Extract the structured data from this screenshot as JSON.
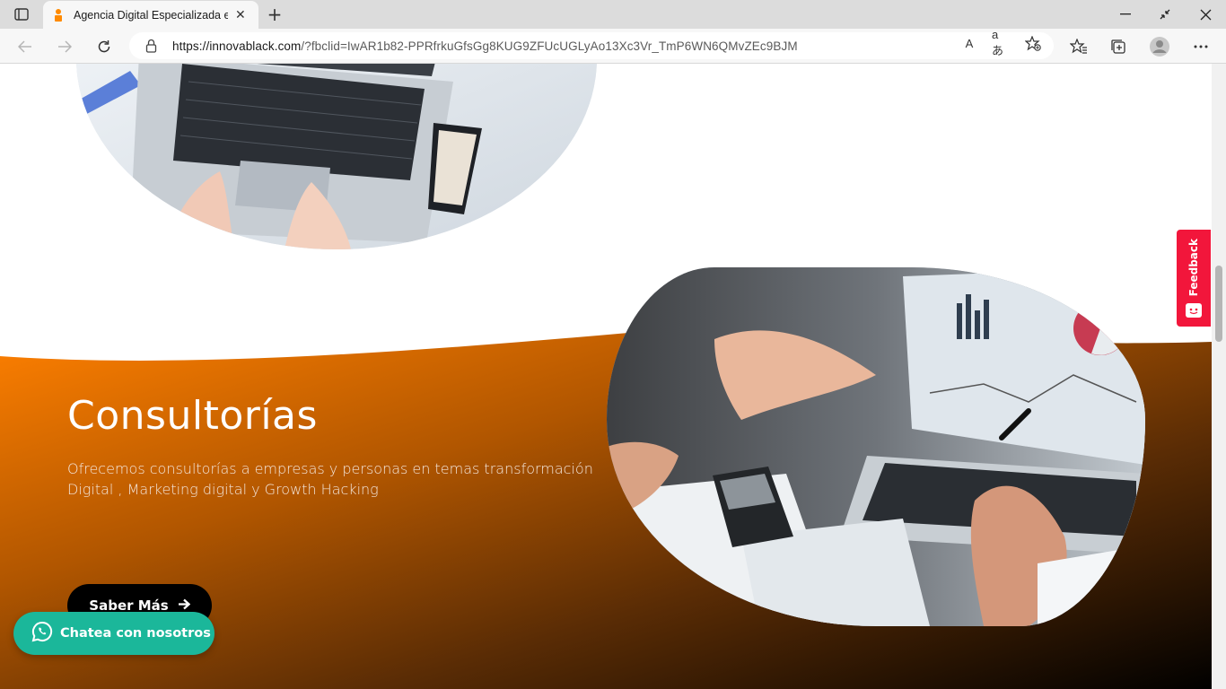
{
  "browser": {
    "tab_title": "Agencia Digital Especializada en",
    "url_host": "https://innovablack.com",
    "url_rest": "/?fbclid=IwAR1b82-PPRfrkuGfsGg8KUG9ZFUcUGLyAo13Xc3Vr_TmP6WN6QMvZEc9BJM",
    "read_aloud_icon": "A",
    "translate_icon": "aあ"
  },
  "colors": {
    "orange": "#ff7a00",
    "dark": "#000000",
    "feedback_red": "#f2163b",
    "whatsapp_green": "#1bb79a"
  },
  "section": {
    "title": "Consultorías",
    "description": "Ofrecemos consultorías a empresas y personas en temas transformación Digital , Marketing digital y Growth Hacking",
    "cta_label": "Saber Más"
  },
  "feedback": {
    "label": "Feedback"
  },
  "whatsapp": {
    "label": "Chatea con nosotros"
  }
}
